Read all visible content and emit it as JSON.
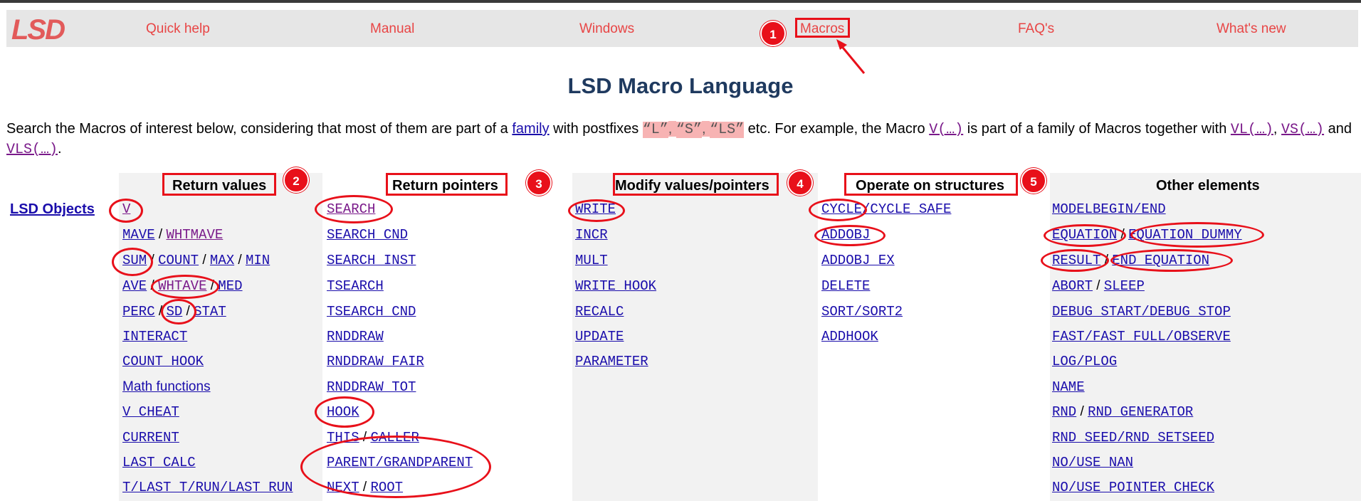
{
  "logo": "LSD",
  "nav": [
    "Quick help",
    "Manual",
    "Windows",
    "Macros",
    "FAQ's",
    "What's new"
  ],
  "page_title": "LSD Macro Language",
  "intro": {
    "t1": "Search the Macros of interest below, considering that most of them are part of a ",
    "family_link": "family",
    "t2": " with postfixes ",
    "q1": "“L”",
    "c1": ", ",
    "q2": "“S”",
    "c2": ", ",
    "q3": "“LS”",
    "t3": " etc. For example, the Macro ",
    "m1": "V(…)",
    "t4": " is part of a family of Macros together with ",
    "m2": "VL(…)",
    "c3": ", ",
    "m3": "VS(…)",
    "t5": " and ",
    "m4": "VLS(…)",
    "t6": "."
  },
  "side_link": "LSD Objects",
  "columns": [
    {
      "header": "Return values",
      "items": [
        "V",
        "MAVE / WHTMAVE",
        "SUM / COUNT / MAX / MIN",
        "AVE / WHTAVE / MED",
        "PERC / SD / STAT",
        "INTERACT",
        "COUNT_HOOK",
        "Math functions",
        "V_CHEAT",
        "CURRENT",
        "LAST_CALC",
        "T/LAST_T/RUN/LAST_RUN"
      ]
    },
    {
      "header": "Return pointers",
      "items": [
        "SEARCH",
        "SEARCH_CND",
        "SEARCH_INST",
        "TSEARCH",
        "TSEARCH_CND",
        "RNDDRAW",
        "RNDDRAW_FAIR",
        "RNDDRAW_TOT",
        "HOOK",
        "THIS / CALLER",
        "PARENT/GRANDPARENT",
        "NEXT / ROOT"
      ]
    },
    {
      "header": "Modify values/pointers",
      "items": [
        "WRITE",
        "INCR",
        "MULT",
        "WRITE_HOOK",
        "RECALC",
        "UPDATE",
        "PARAMETER"
      ]
    },
    {
      "header": "Operate on structures",
      "items": [
        "CYCLE/CYCLE_SAFE",
        "ADDOBJ",
        "ADDOBJ_EX",
        "DELETE",
        "SORT/SORT2",
        "ADDHOOK"
      ]
    },
    {
      "header": "Other elements",
      "items": [
        "MODELBEGIN/END",
        "EQUATION / EQUATION_DUMMY",
        "RESULT / END_EQUATION",
        "ABORT / SLEEP",
        "DEBUG_START/DEBUG_STOP",
        "FAST/FAST_FULL/OBSERVE",
        "LOG/PLOG",
        "NAME",
        "RND / RND_GENERATOR",
        "RND_SEED/RND_SETSEED",
        "NO/USE_NAN",
        "NO/USE_POINTER_CHECK"
      ]
    }
  ],
  "annotations": [
    "1",
    "2",
    "3",
    "4",
    "5"
  ],
  "colors": {
    "accent": "#e8101a",
    "nav_text": "#e84545",
    "link": "#1a0dab",
    "visited": "#7a1a8a",
    "title": "#1f3a5f"
  }
}
